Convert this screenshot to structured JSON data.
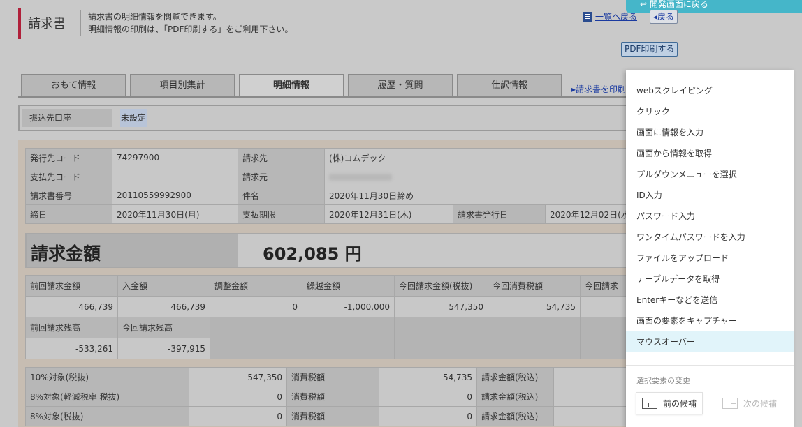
{
  "header": {
    "title": "請求書",
    "desc_line1": "請求書の明細情報を閲覧できます。",
    "desc_line2": "明細情報の印刷は、「PDF印刷する」をご利用下さい。",
    "back_to_list": "一覧へ戻る",
    "back": "◂戻る",
    "pdf_print": "PDF印刷する",
    "dev_return": "↩ 開発画面に戻る"
  },
  "tabs": [
    {
      "label": "おもて情報"
    },
    {
      "label": "項目別集計"
    },
    {
      "label": "明細情報",
      "active": true
    },
    {
      "label": "履歴・質問"
    },
    {
      "label": "仕訳情報"
    }
  ],
  "print_link": "▸請求書を印刷",
  "account": {
    "label": "振込先口座",
    "value": "未設定"
  },
  "info": {
    "issuer_code_label": "発行先コード",
    "issuer_code": "74297900",
    "bill_to_label": "請求先",
    "bill_to": "(株)コムデック",
    "payer_code_label": "支払先コード",
    "payer_code": "",
    "bill_from_label": "請求元",
    "invoice_no_label": "請求書番号",
    "invoice_no": "20110559992900",
    "subject_label": "件名",
    "subject": "2020年11月30日締め",
    "closing_label": "締日",
    "closing": "2020年11月30日(月)",
    "due_label": "支払期限",
    "due": "2020年12月31日(木)",
    "issue_date_label": "請求書発行日",
    "issue_date": "2020年12月02日(水"
  },
  "total": {
    "label": "請求金額",
    "value": "602,085 円"
  },
  "amounts": {
    "headers": [
      "前回請求金額",
      "入金額",
      "調整金額",
      "繰越金額",
      "今回請求金額(税抜)",
      "今回消費税額",
      "今回請求"
    ],
    "values": [
      "466,739",
      "466,739",
      "0",
      "-1,000,000",
      "547,350",
      "54,735",
      ""
    ],
    "headers2": [
      "前回請求残高",
      "今回請求残高"
    ],
    "values2": [
      "-533,261",
      "-397,915"
    ]
  },
  "tax_rows": [
    {
      "label": "10%対象(税抜)",
      "value": "547,350",
      "tax_label": "消費税額",
      "tax": "54,735",
      "total_label": "請求金額(税込)"
    },
    {
      "label": "8%対象(軽減税率 税抜)",
      "value": "0",
      "tax_label": "消費税額",
      "tax": "0",
      "total_label": "請求金額(税込)"
    },
    {
      "label": "8%対象(税抜)",
      "value": "0",
      "tax_label": "消費税額",
      "tax": "0",
      "total_label": "請求金額(税込)"
    }
  ],
  "menu": {
    "items": [
      {
        "label": "webスクレイピング"
      },
      {
        "label": "クリック"
      },
      {
        "label": "画面に情報を入力"
      },
      {
        "label": "画面から情報を取得"
      },
      {
        "label": "プルダウンメニューを選択"
      },
      {
        "label": "ID入力"
      },
      {
        "label": "パスワード入力"
      },
      {
        "label": "ワンタイムパスワードを入力"
      },
      {
        "label": "ファイルをアップロード"
      },
      {
        "label": "テーブルデータを取得"
      },
      {
        "label": "Enterキーなどを送信"
      },
      {
        "label": "画面の要素をキャプチャー"
      },
      {
        "label": "マウスオーバー",
        "hover": true
      }
    ],
    "section_label": "選択要素の変更",
    "prev": "前の候補",
    "next": "次の候補"
  }
}
